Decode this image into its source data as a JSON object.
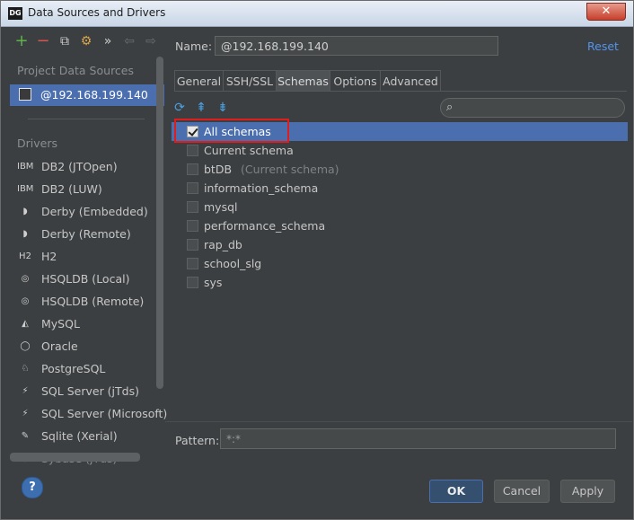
{
  "window": {
    "title": "Data Sources and Drivers",
    "app_icon_text": "DG",
    "close_glyph": "✕"
  },
  "left": {
    "toolbar": {
      "add": "+",
      "remove": "−",
      "copy": "⧉",
      "settings": "⚙",
      "more": "»",
      "back": "⇦",
      "forward": "⇨"
    },
    "project_title": "Project Data Sources",
    "data_source": "@192.168.199.140",
    "drivers_title": "Drivers",
    "drivers": [
      {
        "label": "DB2 (JTOpen)",
        "icon": "IBM"
      },
      {
        "label": "DB2 (LUW)",
        "icon": "IBM"
      },
      {
        "label": "Derby (Embedded)",
        "icon": "◗"
      },
      {
        "label": "Derby (Remote)",
        "icon": "◗"
      },
      {
        "label": "H2",
        "icon": "H2"
      },
      {
        "label": "HSQLDB (Local)",
        "icon": "◎"
      },
      {
        "label": "HSQLDB (Remote)",
        "icon": "◎"
      },
      {
        "label": "MySQL",
        "icon": "◭"
      },
      {
        "label": "Oracle",
        "icon": "◯"
      },
      {
        "label": "PostgreSQL",
        "icon": "♘"
      },
      {
        "label": "SQL Server (jTds)",
        "icon": "⚡"
      },
      {
        "label": "SQL Server (Microsoft)",
        "icon": "⚡"
      },
      {
        "label": "Sqlite (Xerial)",
        "icon": "✎"
      },
      {
        "label": "Sybase (jTds)",
        "icon": "◉"
      }
    ]
  },
  "main": {
    "name_label": "Name:",
    "name_value": "@192.168.199.140",
    "reset": "Reset",
    "tabs": [
      "General",
      "SSH/SSL",
      "Schemas",
      "Options",
      "Advanced"
    ],
    "active_tab": "Schemas",
    "schema_toolbar": {
      "refresh": "⟳",
      "expand": "⇞",
      "collapse": "⇟"
    },
    "search_icon": "⌕",
    "schemas": [
      {
        "label": "All schemas",
        "checked": true,
        "note": ""
      },
      {
        "label": "Current schema",
        "checked": false,
        "note": ""
      },
      {
        "label": "btDB",
        "checked": false,
        "note": "(Current schema)"
      },
      {
        "label": "information_schema",
        "checked": false,
        "note": ""
      },
      {
        "label": "mysql",
        "checked": false,
        "note": ""
      },
      {
        "label": "performance_schema",
        "checked": false,
        "note": ""
      },
      {
        "label": "rap_db",
        "checked": false,
        "note": ""
      },
      {
        "label": "school_slg",
        "checked": false,
        "note": ""
      },
      {
        "label": "sys",
        "checked": false,
        "note": ""
      }
    ],
    "pattern_label": "Pattern:",
    "pattern_value": "*:*"
  },
  "footer": {
    "help": "?",
    "ok": "OK",
    "cancel": "Cancel",
    "apply": "Apply"
  },
  "colors": {
    "selection": "#4b6eaf",
    "highlight": "#e01d1d",
    "link": "#5394ec"
  }
}
